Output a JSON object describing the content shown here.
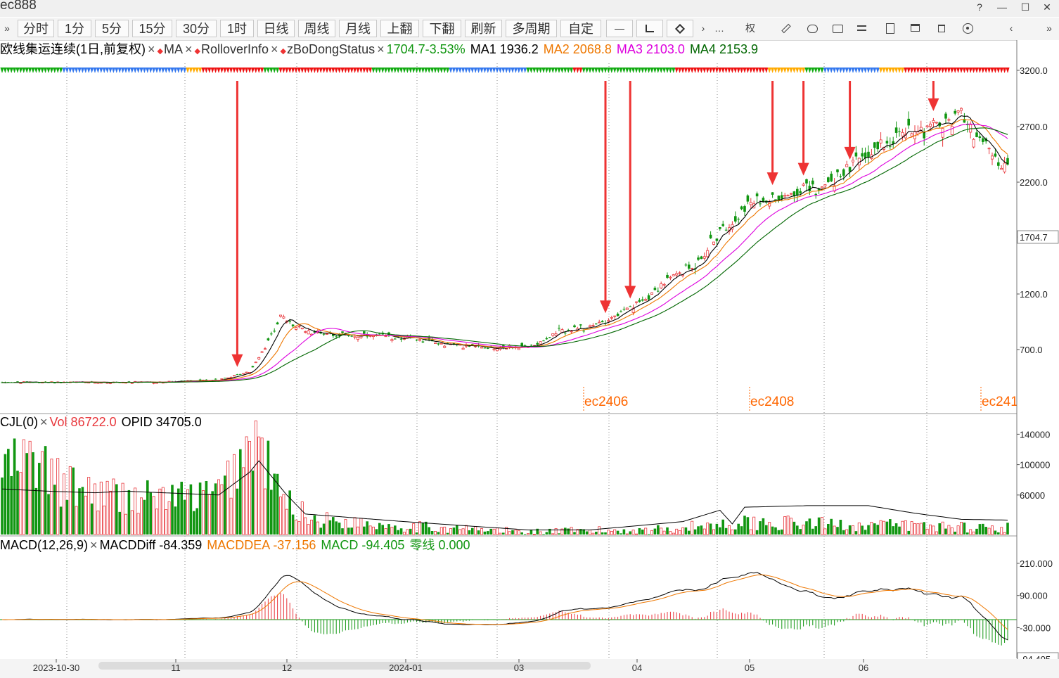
{
  "window": {
    "title": "ec888",
    "buttons": [
      "?",
      "—",
      "☐",
      "✕"
    ]
  },
  "toolbar": {
    "periods": [
      "分时",
      "1分",
      "5分",
      "15分",
      "30分",
      "1时",
      "日线",
      "周线",
      "月线",
      "上翻",
      "下翻",
      "刷新",
      "多周期",
      "自定"
    ],
    "expand_left": "»",
    "more": "…",
    "quan": "权",
    "nav_left": "‹",
    "nav_right": "›"
  },
  "legends": {
    "main": {
      "name": "欧线集运连续(1日,前复权)",
      "ind1": "MA",
      "ind2": "RolloverInfo",
      "ind3": "zBoDongStatus",
      "last": "1704.7",
      "change": "-3.53%",
      "ma1": "MA1 1936.2",
      "ma2": "MA2 2068.8",
      "ma3": "MA3 2103.0",
      "ma4": "MA4 2153.9"
    },
    "vol": {
      "name": "CJL(0)",
      "vol": "Vol 86722.0",
      "opid": "OPID 34705.0"
    },
    "macd": {
      "name": "MACD(12,26,9)",
      "diff": "MACDDiff -84.359",
      "dea": "MACDDEA -37.156",
      "macd": "MACD -94.405",
      "zero": "零线 0.000"
    },
    "close_mark": "×",
    "diamond": "◆"
  },
  "colors": {
    "up": "#e8373c",
    "down": "#119611",
    "ma1": "#000000",
    "ma2": "#ee7700",
    "ma3": "#dd00dd",
    "ma4": "#006600",
    "status_red": "#ee1111",
    "status_green": "#11aa11",
    "status_blue": "#3377ee",
    "status_orange": "#ffaa00",
    "arrow": "#ee3333",
    "rollover": "#ff6600"
  },
  "rollover_labels": [
    "ec2406",
    "ec2408",
    "ec241"
  ],
  "chart_data": [
    {
      "type": "candlestick",
      "title": "欧线集运连续(1日,前复权)",
      "y_ticks": [
        "3200.0",
        "2700.0",
        "2200.0",
        "1200.0",
        "700.0"
      ],
      "last_price_label": "1704.7",
      "ylim": [
        210,
        3260
      ],
      "x_ticks": [
        "2023-10-30",
        "11",
        "12",
        "2024-01",
        "03",
        "04",
        "05",
        "06"
      ],
      "anchors": [
        [
          0,
          300
        ],
        [
          50,
          300
        ],
        [
          70,
          330
        ],
        [
          80,
          430
        ],
        [
          90,
          1000
        ],
        [
          95,
          900
        ],
        [
          100,
          860
        ],
        [
          115,
          820
        ],
        [
          130,
          810
        ],
        [
          140,
          760
        ],
        [
          155,
          720
        ],
        [
          170,
          720
        ],
        [
          180,
          860
        ],
        [
          190,
          900
        ],
        [
          198,
          1000
        ],
        [
          205,
          1100
        ],
        [
          215,
          1320
        ],
        [
          225,
          1480
        ],
        [
          230,
          1680
        ],
        [
          240,
          1980
        ],
        [
          248,
          2050
        ],
        [
          258,
          2130
        ],
        [
          265,
          2150
        ],
        [
          275,
          2350
        ],
        [
          285,
          2560
        ],
        [
          295,
          2680
        ],
        [
          305,
          2720
        ],
        [
          310,
          2830
        ],
        [
          318,
          2500
        ],
        [
          323,
          2350
        ],
        [
          325,
          2300
        ]
      ],
      "num_bars": 326,
      "moving_averages": [
        {
          "name": "MA1",
          "last": 1936.2
        },
        {
          "name": "MA2",
          "last": 2068.8
        },
        {
          "name": "MA3",
          "last": 2103.0
        },
        {
          "name": "MA4",
          "last": 2153.9
        }
      ],
      "status_bar_segments": [
        [
          "green",
          20
        ],
        [
          "blue",
          40
        ],
        [
          "orange",
          5
        ],
        [
          "red",
          20
        ],
        [
          "green",
          5
        ],
        [
          "red",
          30
        ],
        [
          "green",
          25
        ],
        [
          "blue",
          25
        ],
        [
          "green",
          15
        ],
        [
          "red",
          3
        ],
        [
          "green",
          30
        ],
        [
          "red",
          30
        ],
        [
          "orange",
          12
        ],
        [
          "green",
          6
        ],
        [
          "blue",
          18
        ],
        [
          "orange",
          8
        ],
        [
          "red",
          14
        ],
        [
          "red",
          20
        ]
      ],
      "signal_arrows_bar_index": [
        76,
        195,
        203,
        249,
        259,
        274,
        301
      ]
    },
    {
      "type": "bar",
      "title": "CJL(0)",
      "y_ticks": [
        "140000",
        "100000",
        "60000"
      ],
      "ylim": [
        8000,
        145000
      ],
      "series": [
        {
          "name": "Vol",
          "last": 86722.0
        },
        {
          "name": "OPID",
          "last": 34705.0
        }
      ],
      "vol_anchors": [
        [
          0,
          100000
        ],
        [
          10,
          110000
        ],
        [
          20,
          75000
        ],
        [
          40,
          60000
        ],
        [
          60,
          60000
        ],
        [
          70,
          65000
        ],
        [
          78,
          120000
        ],
        [
          82,
          140000
        ],
        [
          90,
          60000
        ],
        [
          100,
          30000
        ],
        [
          130,
          20000
        ],
        [
          170,
          12000
        ],
        [
          210,
          15000
        ],
        [
          240,
          25000
        ],
        [
          280,
          22000
        ],
        [
          325,
          18000
        ]
      ],
      "opid_anchors": [
        [
          0,
          68000
        ],
        [
          15,
          65000
        ],
        [
          30,
          63000
        ],
        [
          40,
          65000
        ],
        [
          58,
          62000
        ],
        [
          70,
          60000
        ],
        [
          80,
          90000
        ],
        [
          83,
          105000
        ],
        [
          92,
          60000
        ],
        [
          98,
          35000
        ],
        [
          130,
          25000
        ],
        [
          170,
          14000
        ],
        [
          190,
          14000
        ],
        [
          220,
          25000
        ],
        [
          232,
          40000
        ],
        [
          236,
          22000
        ],
        [
          240,
          44000
        ],
        [
          260,
          46000
        ],
        [
          280,
          46000
        ],
        [
          295,
          36000
        ],
        [
          310,
          28000
        ],
        [
          325,
          27000
        ]
      ]
    },
    {
      "type": "macd",
      "title": "MACD(12,26,9)",
      "y_ticks": [
        "210.000",
        "90.000",
        "-30.000"
      ],
      "last_value_label": "-94.405",
      "ylim": [
        -130,
        250
      ],
      "series": [
        {
          "name": "MACDDiff",
          "last": -84.359
        },
        {
          "name": "MACDDEA",
          "last": -37.156
        },
        {
          "name": "MACD",
          "last": -94.405
        },
        {
          "name": "零线",
          "last": 0.0
        }
      ]
    }
  ]
}
